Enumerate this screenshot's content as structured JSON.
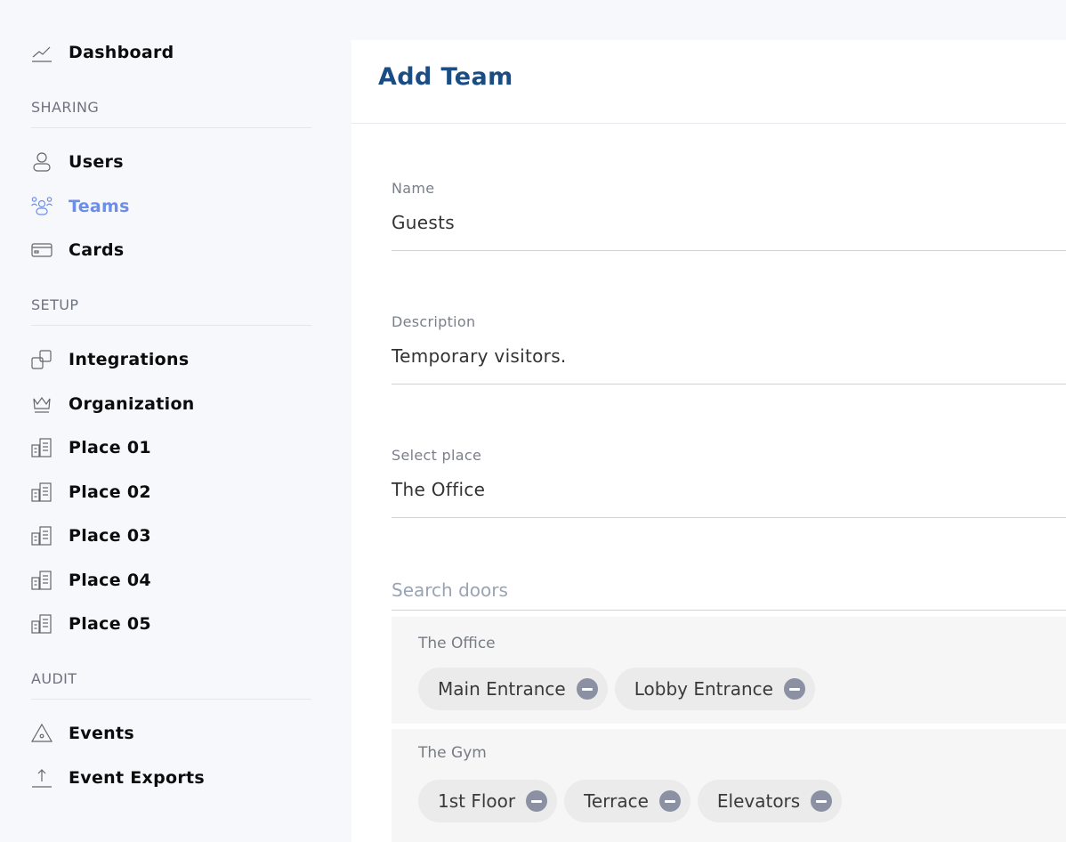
{
  "sidebar": {
    "top_item": {
      "label": "Dashboard",
      "icon": "chart-line-icon"
    },
    "sections": [
      {
        "label": "SHARING",
        "items": [
          {
            "label": "Users",
            "icon": "user-icon",
            "active": false
          },
          {
            "label": "Teams",
            "icon": "team-icon",
            "active": true
          },
          {
            "label": "Cards",
            "icon": "card-icon",
            "active": false
          }
        ]
      },
      {
        "label": "SETUP",
        "items": [
          {
            "label": "Integrations",
            "icon": "integrations-icon"
          },
          {
            "label": "Organization",
            "icon": "crown-icon"
          },
          {
            "label": "Place 01",
            "icon": "building-icon"
          },
          {
            "label": "Place 02",
            "icon": "building-icon"
          },
          {
            "label": "Place 03",
            "icon": "building-icon"
          },
          {
            "label": "Place 04",
            "icon": "building-icon"
          },
          {
            "label": "Place 05",
            "icon": "building-icon"
          }
        ]
      },
      {
        "label": "AUDIT",
        "items": [
          {
            "label": "Events",
            "icon": "warning-icon"
          },
          {
            "label": "Event Exports",
            "icon": "export-icon"
          }
        ]
      }
    ]
  },
  "form": {
    "title": "Add Team",
    "name": {
      "label": "Name",
      "value": "Guests"
    },
    "description": {
      "label": "Description",
      "value": "Temporary visitors."
    },
    "place": {
      "label": "Select place",
      "value": "The Office"
    },
    "search": {
      "placeholder": "Search doors"
    },
    "door_groups": [
      {
        "title": "The Office",
        "doors": [
          "Main Entrance",
          "Lobby Entrance"
        ]
      },
      {
        "title": "The Gym",
        "doors": [
          "1st Floor",
          "Terrace",
          "Elevators"
        ]
      }
    ]
  },
  "colors": {
    "accent": "#6d8ee8",
    "title": "#1b4d82",
    "chip_remove": "#8b90a3"
  }
}
